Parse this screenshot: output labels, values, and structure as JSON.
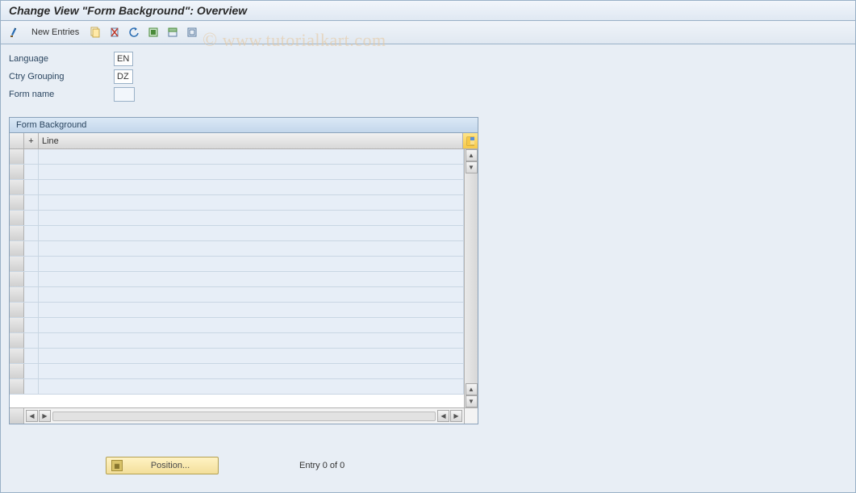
{
  "title": "Change View \"Form Background\": Overview",
  "toolbar": {
    "new_entries_label": "New Entries"
  },
  "form": {
    "language_label": "Language",
    "language_value": "EN",
    "ctry_label": "Ctry Grouping",
    "ctry_value": "DZ",
    "formname_label": "Form name",
    "formname_value": ""
  },
  "grid": {
    "title": "Form Background",
    "col_plus": "+",
    "col_line": "Line"
  },
  "footer": {
    "position_label": "Position...",
    "entry_text": "Entry 0 of 0"
  },
  "watermark": "© www.tutorialkart.com"
}
